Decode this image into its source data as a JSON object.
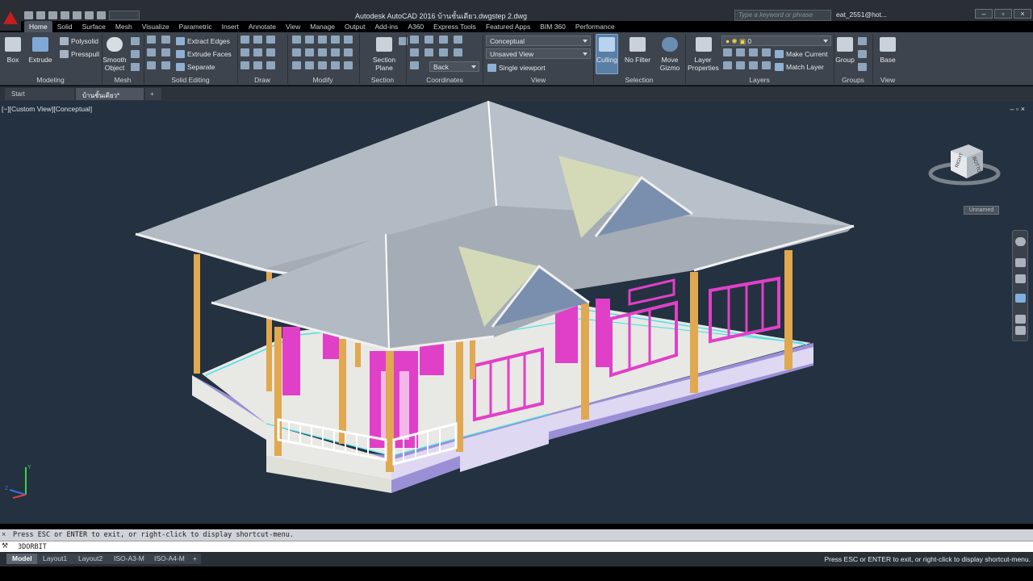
{
  "title_bar": {
    "doc_title": "Autodesk AutoCAD 2016   บ้านชั้นเดียว.dwgstep 2.dwg",
    "search_placeholder": "Type a keyword or phrase",
    "user": "eat_2551@hot...",
    "help": "?"
  },
  "ribbon_tabs": [
    "Home",
    "Solid",
    "Surface",
    "Mesh",
    "Visualize",
    "Parametric",
    "Insert",
    "Annotate",
    "View",
    "Manage",
    "Output",
    "Add-ins",
    "A360",
    "Express Tools",
    "Featured Apps",
    "BIM 360",
    "Performance"
  ],
  "ribbon": {
    "modeling": {
      "label": "Modeling",
      "box": "Box",
      "extrude": "Extrude",
      "polysolid": "Polysolid",
      "presspull": "Presspull"
    },
    "mesh": {
      "label": "Mesh",
      "smooth": "Smooth",
      "object": "Object"
    },
    "solid_editing": {
      "label": "Solid Editing",
      "extract_edges": "Extract Edges",
      "extrude_faces": "Extrude Faces",
      "separate": "Separate"
    },
    "draw": {
      "label": "Draw"
    },
    "modify": {
      "label": "Modify"
    },
    "section": {
      "label": "Section",
      "section_line1": "Section",
      "section_line2": "Plane"
    },
    "coordinates": {
      "label": "Coordinates",
      "back": "Back"
    },
    "view": {
      "label": "View",
      "visual_style": "Conceptual",
      "saved_view": "Unsaved View",
      "viewport": "Single viewport"
    },
    "selection": {
      "label": "Selection",
      "culling": "Culling",
      "no_filter": "No Filter",
      "move_line1": "Move",
      "move_line2": "Gizmo"
    },
    "layers": {
      "label": "Layers",
      "layer_properties_line1": "Layer",
      "layer_properties_line2": "Properties",
      "current_layer": "0",
      "make_current": "Make Current",
      "match_layer": "Match Layer"
    },
    "groups": {
      "label": "Groups",
      "group": "Group"
    },
    "view2": {
      "label": "View",
      "base": "Base"
    }
  },
  "file_tabs": {
    "start": "Start",
    "drawing": "บ้านชั้นเดียว*",
    "add": "+"
  },
  "viewport": {
    "label": "[−][Custom View][Conceptual]",
    "controls": "–  ▫  ×",
    "wcs": "Unnamed",
    "cube_faces": [
      "RIGHT",
      "BOTTOM"
    ],
    "ucs_y": "Y",
    "ucs_z": "Z"
  },
  "command": {
    "history": "Press ESC or ENTER to exit, or right-click to display shortcut-menu.",
    "current": "3DORBIT"
  },
  "layout_tabs": [
    "Model",
    "Layout1",
    "Layout2",
    "ISO-A3-M",
    "ISO-A4-M",
    "+"
  ],
  "status_message": "Press ESC or ENTER to exit, or right-click to display shortcut-menu.",
  "colors": {
    "accent": "#c41d1d",
    "viewport_bg": "#233140",
    "roof": "#9aa2ac",
    "wall_magenta": "#e040c8",
    "column_orange": "#e0a850",
    "floor": "#e8e8e4",
    "base_purple": "#9b8fd6",
    "edge_cyan": "#4ee0e8"
  }
}
